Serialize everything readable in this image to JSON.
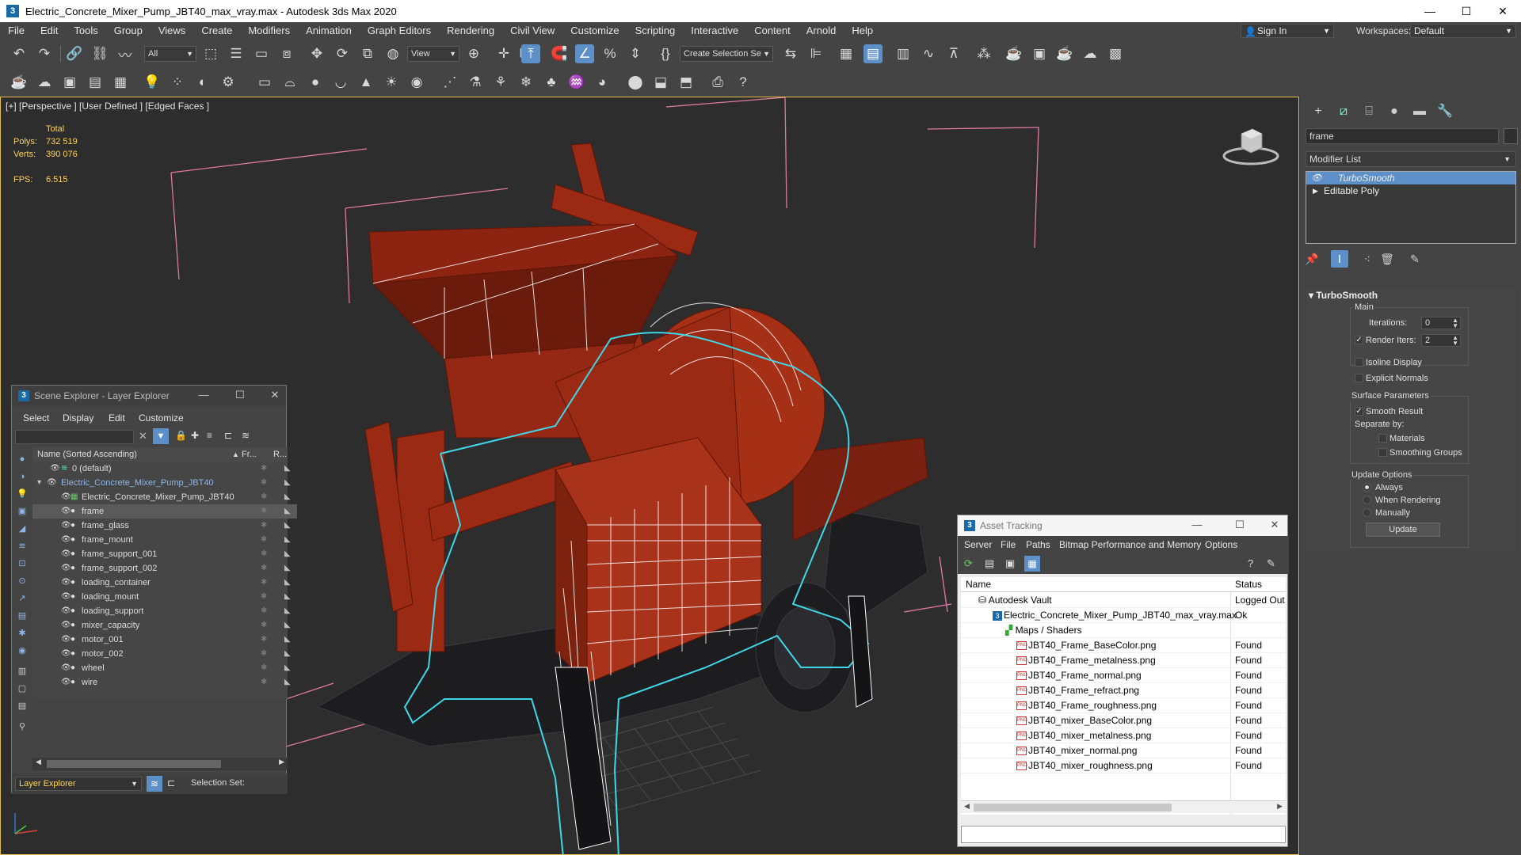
{
  "window": {
    "title": "Electric_Concrete_Mixer_Pump_JBT40_max_vray.max - Autodesk 3ds Max 2020",
    "minimize": "—",
    "maximize": "☐",
    "close": "✕"
  },
  "menu": [
    "File",
    "Edit",
    "Tools",
    "Group",
    "Views",
    "Create",
    "Modifiers",
    "Animation",
    "Graph Editors",
    "Rendering",
    "Civil View",
    "Customize",
    "Scripting",
    "Interactive",
    "Content",
    "Arnold",
    "Help"
  ],
  "account": {
    "signin": "Sign In",
    "workspaces_label": "Workspaces:",
    "workspace": "Default"
  },
  "toolbar": {
    "filter": "All",
    "ref_coord": "View",
    "selection_set": "Create Selection Se"
  },
  "viewport": {
    "label": "[+] [Perspective ] [User Defined ] [Edged Faces ]",
    "stats": {
      "total_label": "Total",
      "polys_label": "Polys:",
      "polys_value": "732 519",
      "verts_label": "Verts:",
      "verts_value": "390 076",
      "fps_label": "FPS:",
      "fps_value": "6.515"
    }
  },
  "command_panel": {
    "object_name": "frame",
    "modifier_list": "Modifier List",
    "stack": [
      "TurboSmooth",
      "Editable Poly"
    ],
    "turbosmooth": {
      "header": "TurboSmooth",
      "main": "Main",
      "iterations_label": "Iterations:",
      "iterations": "0",
      "render_iters_label": "Render Iters:",
      "render_iters": "2",
      "isoline": "Isoline Display",
      "explicit_normals": "Explicit Normals",
      "surface_params": "Surface Parameters",
      "smooth_result": "Smooth Result",
      "separate_by": "Separate by:",
      "materials": "Materials",
      "smoothing_groups": "Smoothing Groups",
      "update_options": "Update Options",
      "always": "Always",
      "when_rendering": "When Rendering",
      "manually": "Manually",
      "update_button": "Update"
    }
  },
  "scene_explorer": {
    "title": "Scene Explorer - Layer Explorer",
    "menu": [
      "Select",
      "Display",
      "Edit",
      "Customize"
    ],
    "col_name": "Name (Sorted Ascending)",
    "col_frozen": "Fr...",
    "col_render": "R...",
    "rows": [
      {
        "name": "0 (default)",
        "indent": 0
      },
      {
        "name": "Electric_Concrete_Mixer_Pump_JBT40",
        "indent": 1
      },
      {
        "name": "Electric_Concrete_Mixer_Pump_JBT40",
        "indent": 2
      },
      {
        "name": "frame",
        "indent": 2
      },
      {
        "name": "frame_glass",
        "indent": 2
      },
      {
        "name": "frame_mount",
        "indent": 2
      },
      {
        "name": "frame_support_001",
        "indent": 2
      },
      {
        "name": "frame_support_002",
        "indent": 2
      },
      {
        "name": "loading_container",
        "indent": 2
      },
      {
        "name": "loading_mount",
        "indent": 2
      },
      {
        "name": "loading_support",
        "indent": 2
      },
      {
        "name": "mixer_capacity",
        "indent": 2
      },
      {
        "name": "motor_001",
        "indent": 2
      },
      {
        "name": "motor_002",
        "indent": 2
      },
      {
        "name": "wheel",
        "indent": 2
      },
      {
        "name": "wire",
        "indent": 2
      }
    ],
    "footer_explorer": "Layer Explorer",
    "footer_selset": "Selection Set:"
  },
  "asset_tracking": {
    "title": "Asset Tracking",
    "menu": [
      "Server",
      "File",
      "Paths",
      "Bitmap Performance and Memory",
      "Options"
    ],
    "col_name": "Name",
    "col_status": "Status",
    "rows": [
      {
        "name": "Autodesk Vault",
        "status": "Logged Out",
        "level": 0
      },
      {
        "name": "Electric_Concrete_Mixer_Pump_JBT40_max_vray.max",
        "status": "Ok",
        "level": 1
      },
      {
        "name": "Maps / Shaders",
        "status": "",
        "level": 2
      },
      {
        "name": "JBT40_Frame_BaseColor.png",
        "status": "Found",
        "level": 3
      },
      {
        "name": "JBT40_Frame_metalness.png",
        "status": "Found",
        "level": 3
      },
      {
        "name": "JBT40_Frame_normal.png",
        "status": "Found",
        "level": 3
      },
      {
        "name": "JBT40_Frame_refract.png",
        "status": "Found",
        "level": 3
      },
      {
        "name": "JBT40_Frame_roughness.png",
        "status": "Found",
        "level": 3
      },
      {
        "name": "JBT40_mixer_BaseColor.png",
        "status": "Found",
        "level": 3
      },
      {
        "name": "JBT40_mixer_metalness.png",
        "status": "Found",
        "level": 3
      },
      {
        "name": "JBT40_mixer_normal.png",
        "status": "Found",
        "level": 3
      },
      {
        "name": "JBT40_mixer_roughness.png",
        "status": "Found",
        "level": 3
      }
    ]
  },
  "colors": {
    "accent": "#5d8fc9",
    "model_red": "#9b2a14",
    "selection_outline": "#3fd6e8",
    "viewport_border": "#e0c050",
    "stats_text": "#ffd35a"
  }
}
